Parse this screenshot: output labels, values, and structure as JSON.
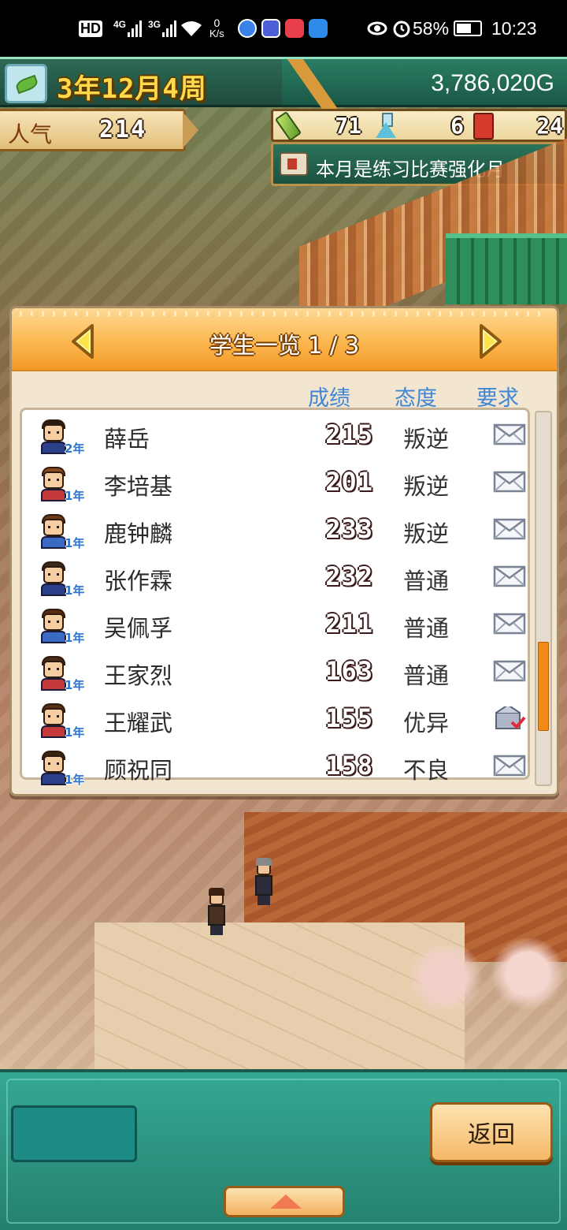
{
  "status_bar": {
    "hd": "HD",
    "net_4g": "4G",
    "net_3g": "3G",
    "speed_value": "0",
    "speed_unit": "K/s",
    "battery": "58%",
    "time": "10:23",
    "icons": [
      "hd-icon",
      "signal-icon",
      "wifi-icon",
      "app-notification-icon",
      "eye-icon",
      "alarm-icon",
      "battery-icon"
    ]
  },
  "hud": {
    "date": "3年12月4周",
    "money": "3,786,020G",
    "popularity_label": "人气",
    "popularity_value": "214",
    "resources": {
      "pencil_value": "71",
      "flask_value": "6",
      "book_value": "24"
    },
    "event_text": "本月是练习比赛强化月"
  },
  "panel": {
    "title": "学生一览 1 / 3",
    "columns": {
      "score": "成绩",
      "attitude": "态度",
      "request": "要求"
    },
    "scroll_position": 0.52,
    "scroll_visible_fraction": 0.52,
    "students": [
      {
        "name": "薛岳",
        "grade": "2年",
        "score": "215",
        "attitude": "叛逆",
        "request": "mail"
      },
      {
        "name": "李培基",
        "grade": "1年",
        "score": "201",
        "attitude": "叛逆",
        "request": "mail"
      },
      {
        "name": "鹿钟麟",
        "grade": "1年",
        "score": "233",
        "attitude": "叛逆",
        "request": "mail"
      },
      {
        "name": "张作霖",
        "grade": "1年",
        "score": "232",
        "attitude": "普通",
        "request": "mail"
      },
      {
        "name": "吴佩孚",
        "grade": "1年",
        "score": "211",
        "attitude": "普通",
        "request": "mail"
      },
      {
        "name": "王家烈",
        "grade": "1年",
        "score": "163",
        "attitude": "普通",
        "request": "mail"
      },
      {
        "name": "王耀武",
        "grade": "1年",
        "score": "155",
        "attitude": "优异",
        "request": "mail-done"
      },
      {
        "name": "顾祝同",
        "grade": "1年",
        "score": "158",
        "attitude": "不良",
        "request": "mail"
      }
    ]
  },
  "bottom": {
    "back_label": "返回"
  },
  "colors": {
    "accent_orange": "#f39a28",
    "column_blue": "#3f86d6",
    "hud_green": "#2b7d63",
    "date_yellow": "#ffd94a"
  }
}
